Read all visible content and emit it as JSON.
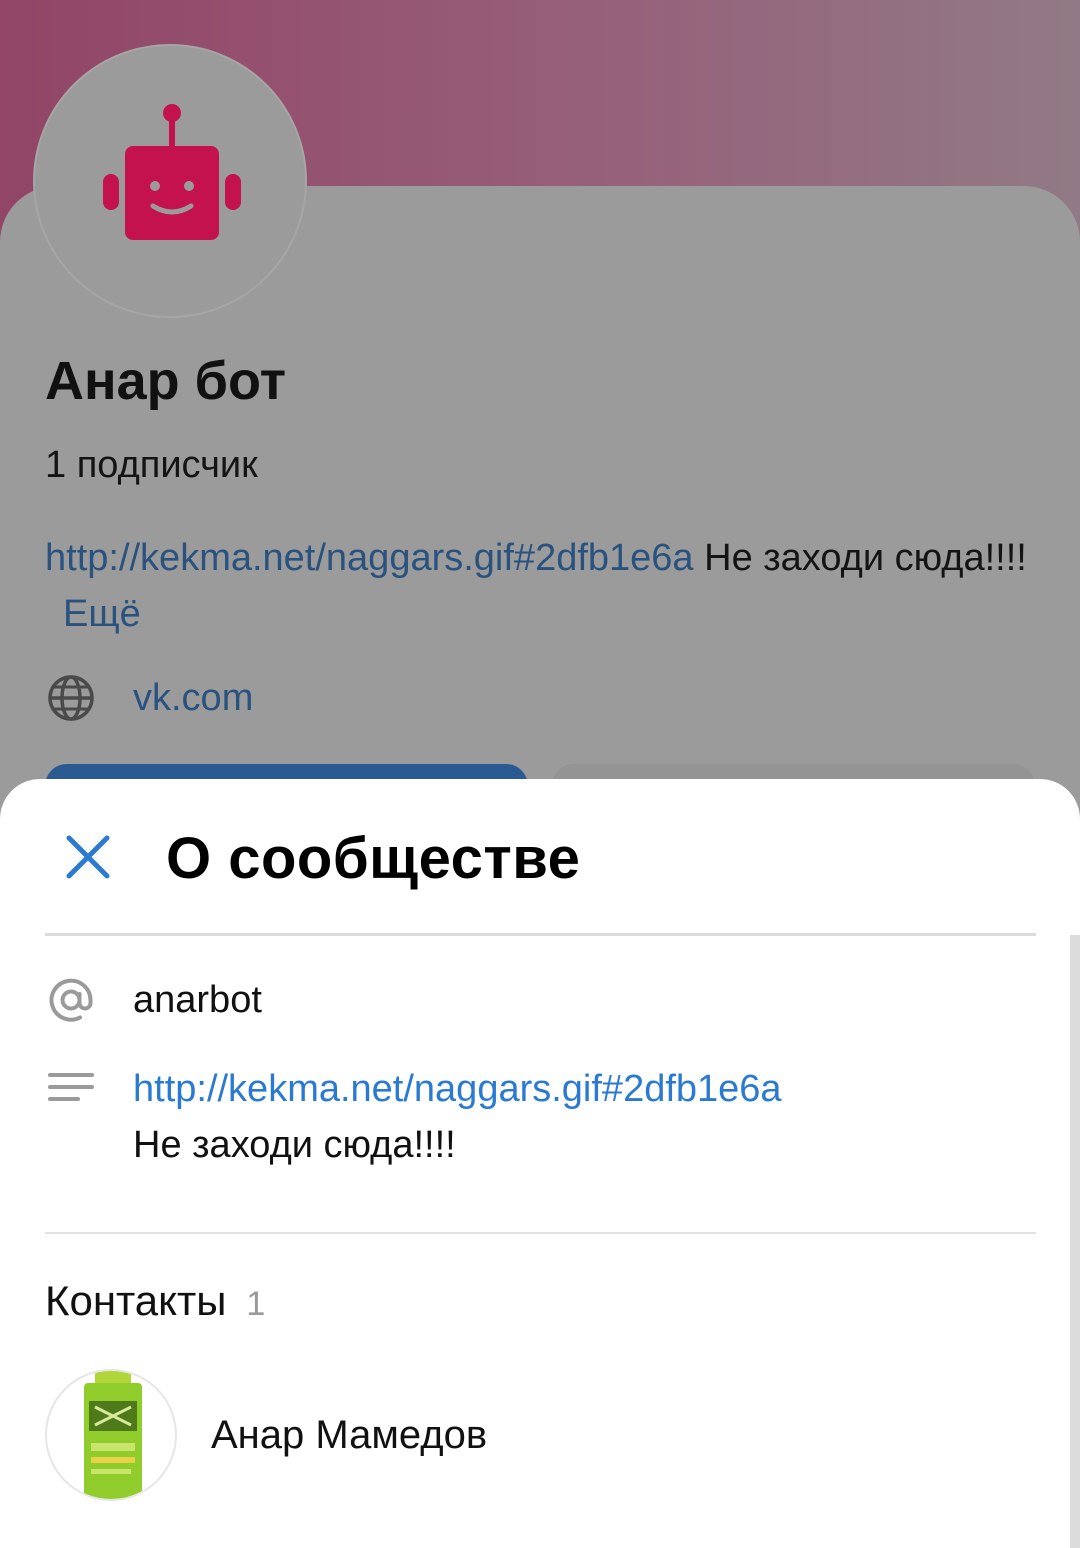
{
  "profile": {
    "name": "Анар бот",
    "subscribers": "1 подписчик",
    "description_link": "http://kekma.net/naggars.gif#2dfb1e6a",
    "description_text": " Не заходи сюда!!!!",
    "more_label": "Ещё",
    "website": "vk.com",
    "avatar_icon": "robot-icon",
    "avatar_color": "#c4124e"
  },
  "sheet": {
    "title": "О сообществе",
    "close_icon": "close-icon",
    "screen_name": "anarbot",
    "description_link": "http://kekma.net/naggars.gif#2dfb1e6a",
    "description_text": "Не заходи сюда!!!!",
    "contacts_title": "Контакты",
    "contacts_count": "1",
    "contacts": [
      {
        "name": "Анар Мамедов",
        "avatar_icon": "spray-bottle-icon"
      }
    ]
  },
  "colors": {
    "accent_blue": "#2a7ad3",
    "cover_gradient_start": "#924566",
    "dim_overlay": "#9b9b9b"
  }
}
